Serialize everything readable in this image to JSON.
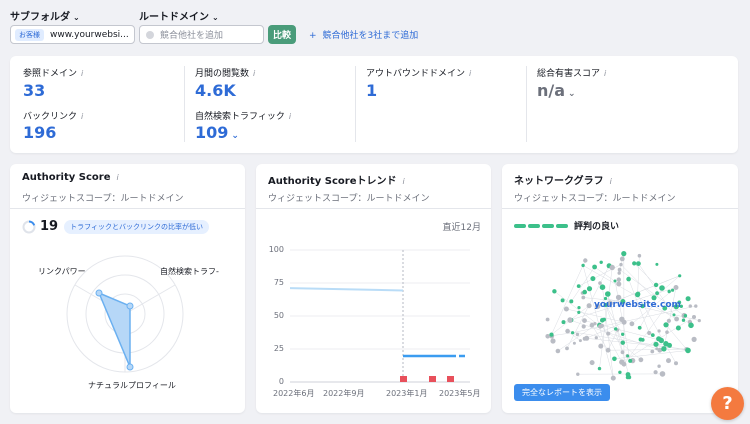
{
  "filters": {
    "subfolder_label": "サブフォルダ",
    "root_domain_label": "ルートドメイン",
    "domain_badge": "お客様",
    "domain_value": "www.yourwebsi...",
    "competitor_placeholder": "競合他社を追加",
    "compare_label": "比較",
    "add_competitors_label": "競合他社を3社まで追加"
  },
  "metrics": {
    "referring_domains": {
      "label": "参照ドメイン",
      "value": "33"
    },
    "backlinks": {
      "label": "バックリンク",
      "value": "196"
    },
    "monthly_visits": {
      "label": "月間の閲覧数",
      "value": "4.6K"
    },
    "organic_traffic": {
      "label": "自然検索トラフィック",
      "value": "109"
    },
    "outbound_domains": {
      "label": "アウトバウンドドメイン",
      "value": "1"
    },
    "toxicity_score": {
      "label": "総合有害スコア",
      "value": "n/a"
    }
  },
  "authority": {
    "title": "Authority Score",
    "scope": "ウィジェットスコープ：ルートドメイン",
    "score": "19",
    "note": "トラフィックとバックリンクの比率が低い",
    "axis_link_power": "リンクパワー",
    "axis_organic": "自然検索トラフ-",
    "axis_natural": "ナチュラルプロフィール"
  },
  "trend": {
    "title": "Authority Scoreトレンド",
    "scope": "ウィジェットスコープ：ルートドメイン",
    "period": "直近12月",
    "y_ticks": [
      "100",
      "75",
      "50",
      "25",
      "0"
    ],
    "x_ticks": [
      "2022年6月",
      "2022年9月",
      "2023年1月",
      "2023年5月"
    ]
  },
  "network": {
    "title": "ネットワークグラフ",
    "scope": "ウィジェットスコープ：ルートドメイン",
    "legend": "評判の良い",
    "center_label": "yourwebsite.com",
    "report_button": "完全なレポートを表示"
  },
  "help_label": "?",
  "colors": {
    "accent": "#2e6bd6",
    "good": "#3cc08a",
    "help": "#f47a3f",
    "trend_line": "#b9dcf7",
    "trend_line_recent": "#3b9cf0",
    "flag": "#e8505b"
  },
  "chart_data": {
    "type": "line",
    "x": [
      "2022年6月",
      "2022年9月",
      "2023年1月",
      "2023年5月"
    ],
    "series": [
      {
        "values": [
          70,
          69.5,
          19,
          19
        ]
      }
    ],
    "ylim": [
      0,
      100
    ],
    "grid": true
  }
}
